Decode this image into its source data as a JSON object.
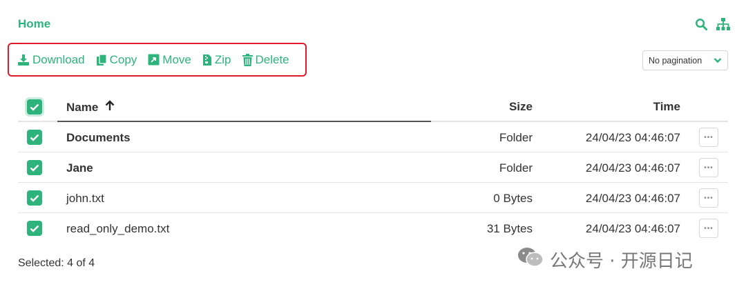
{
  "breadcrumb": {
    "home": "Home"
  },
  "header_icons": [
    "search-icon",
    "sitemap-icon"
  ],
  "toolbar": {
    "download": "Download",
    "copy": "Copy",
    "move": "Move",
    "zip": "Zip",
    "delete": "Delete"
  },
  "pagination": {
    "selected": "No pagination"
  },
  "table": {
    "headers": {
      "name": "Name",
      "size": "Size",
      "time": "Time"
    },
    "rows": [
      {
        "name": "Documents",
        "size": "Folder",
        "time": "24/04/23 04:46:07",
        "is_folder": true
      },
      {
        "name": "Jane",
        "size": "Folder",
        "time": "24/04/23 04:46:07",
        "is_folder": true
      },
      {
        "name": "john.txt",
        "size": "0 Bytes",
        "time": "24/04/23 04:46:07",
        "is_folder": false
      },
      {
        "name": "read_only_demo.txt",
        "size": "31 Bytes",
        "time": "24/04/23 04:46:07",
        "is_folder": false
      }
    ]
  },
  "footer": {
    "selected_text": "Selected: 4 of 4"
  },
  "watermark": {
    "text": "公众号 · 开源日记"
  },
  "colors": {
    "accent": "#2db37b",
    "highlight_border": "#e0192a"
  }
}
